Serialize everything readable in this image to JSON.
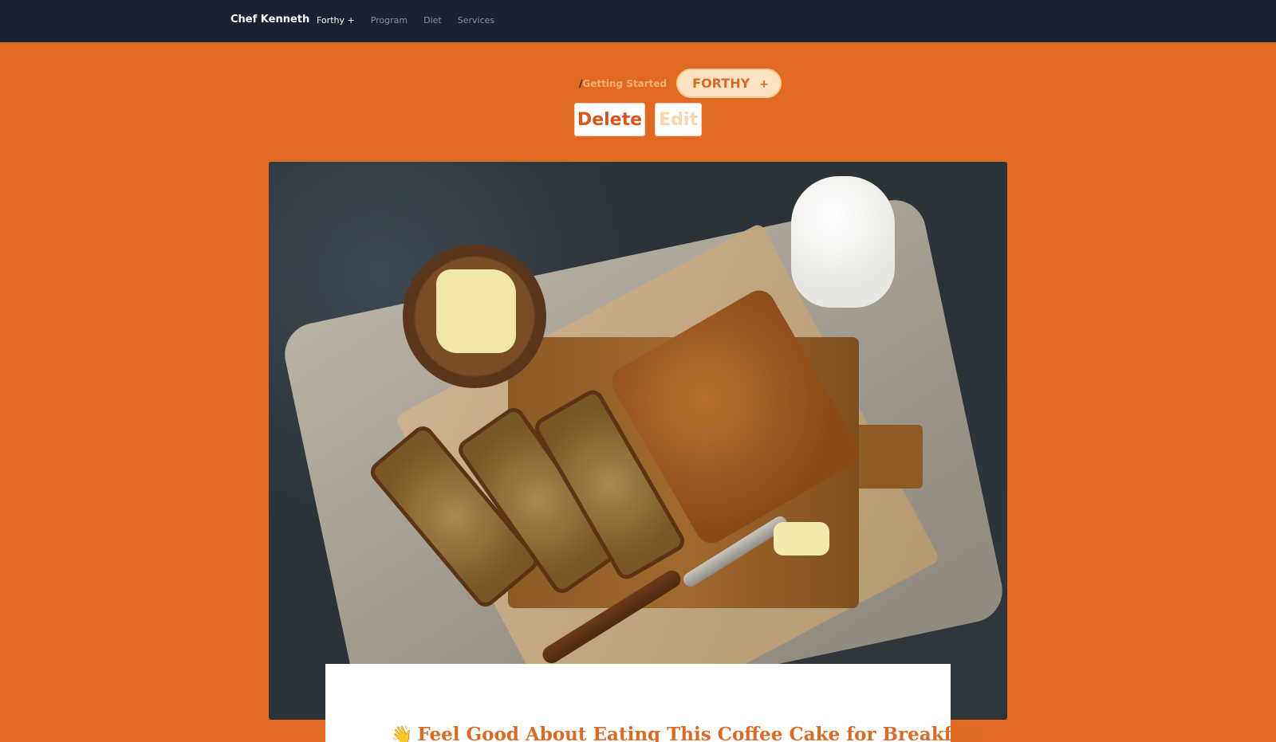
{
  "nav": {
    "brand": "Chef Kenneth",
    "links": [
      "Forthy +",
      "Program",
      "Diet",
      "Services"
    ]
  },
  "breadcrumb": {
    "separator": "/",
    "link": "Getting Started",
    "pill_label": "FORTHY",
    "pill_icon": "+"
  },
  "actions": {
    "delete_label": "Delete",
    "edit_label": "Edit"
  },
  "article": {
    "title_icon": "👋",
    "title": "Feel Good About Eating This Coffee Cake for Breakfast"
  },
  "colors": {
    "page_bg": "#e06a22",
    "nav_bg": "#1b2130",
    "accent": "#dc6a23"
  }
}
